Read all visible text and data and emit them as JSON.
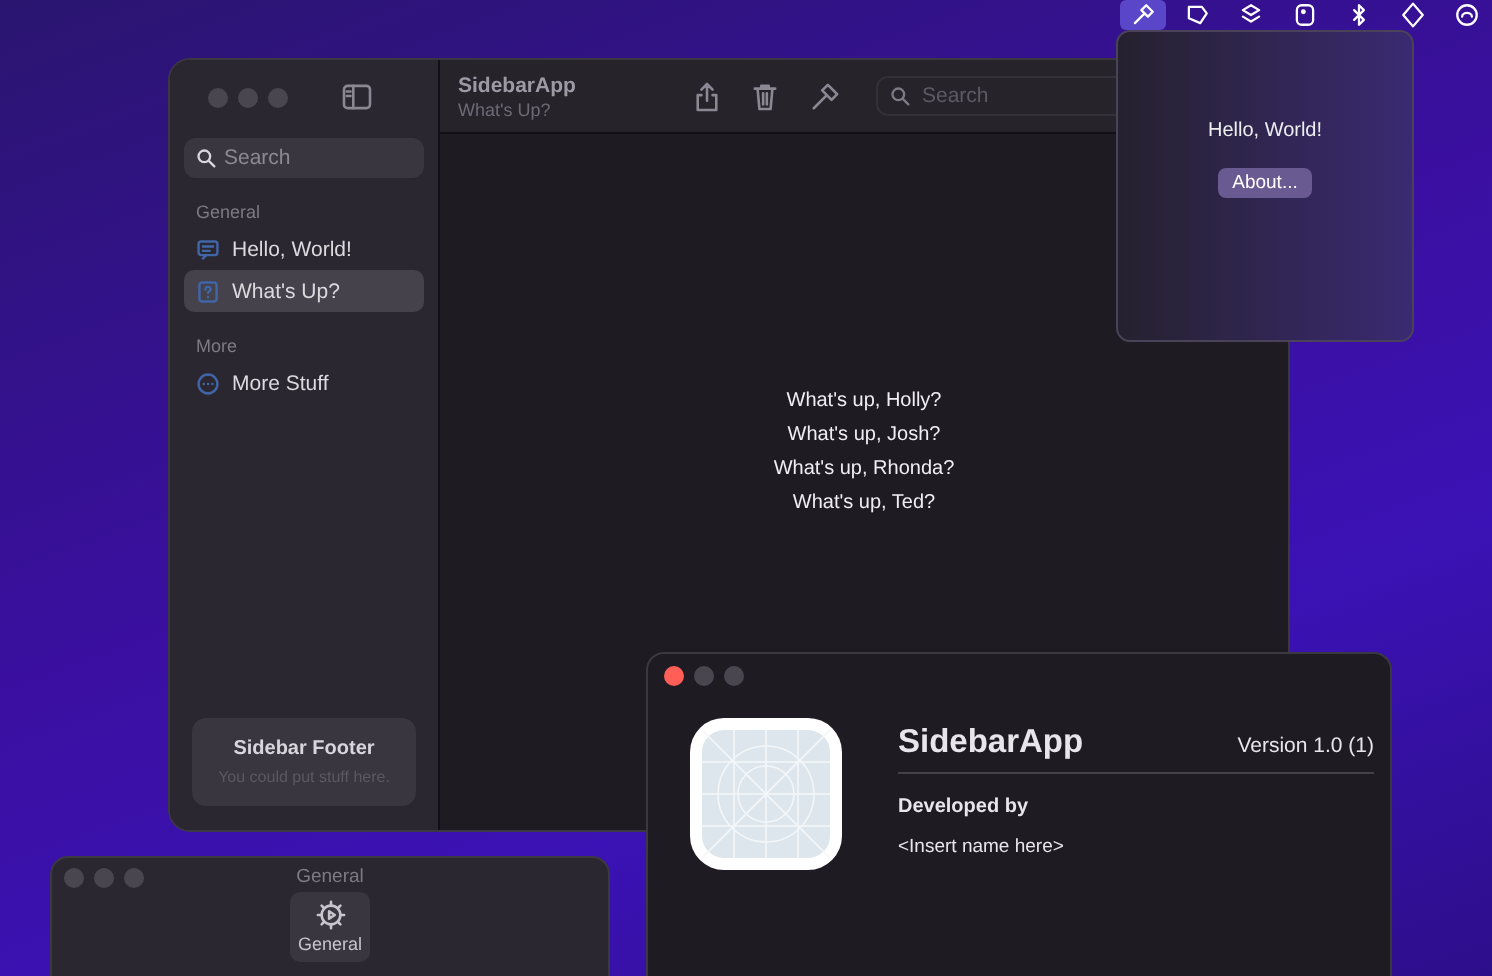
{
  "menu_bar": {
    "items": [
      {
        "kind": "hammer",
        "selected": true
      },
      {
        "kind": "tag",
        "selected": false
      },
      {
        "kind": "layers",
        "selected": false
      },
      {
        "kind": "square",
        "selected": false
      },
      {
        "kind": "bluetooth",
        "selected": false
      },
      {
        "kind": "diamond",
        "selected": false
      },
      {
        "kind": "cloud",
        "selected": false
      }
    ]
  },
  "main_window": {
    "focused": false,
    "sidebar": {
      "search": {
        "placeholder": "Search"
      },
      "sections": [
        {
          "title": "General",
          "items": [
            {
              "label": "Hello, World!",
              "kind": "message",
              "selected": false
            },
            {
              "label": "What's Up?",
              "kind": "question",
              "selected": true
            }
          ]
        },
        {
          "title": "More",
          "items": [
            {
              "label": "More Stuff",
              "kind": "ellipsis",
              "selected": false
            }
          ]
        }
      ],
      "footer": {
        "title": "Sidebar Footer",
        "subtitle": "You could put stuff here."
      }
    },
    "toolbar": {
      "title": "SidebarApp",
      "subtitle": "What's Up?",
      "search": {
        "placeholder": "Search"
      }
    },
    "content": {
      "lines": [
        "What's up, Holly?",
        "What's up, Josh?",
        "What's up, Rhonda?",
        "What's up, Ted?"
      ]
    }
  },
  "popover": {
    "message": "Hello, World!",
    "button": "About..."
  },
  "about_window": {
    "focused": true,
    "app_name": "SidebarApp",
    "version": "Version 1.0 (1)",
    "developed_by_label": "Developed by",
    "developer": "<Insert name here>"
  },
  "settings_window": {
    "focused": false,
    "title": "General",
    "tabs": [
      {
        "label": "General",
        "selected": true
      }
    ]
  }
}
